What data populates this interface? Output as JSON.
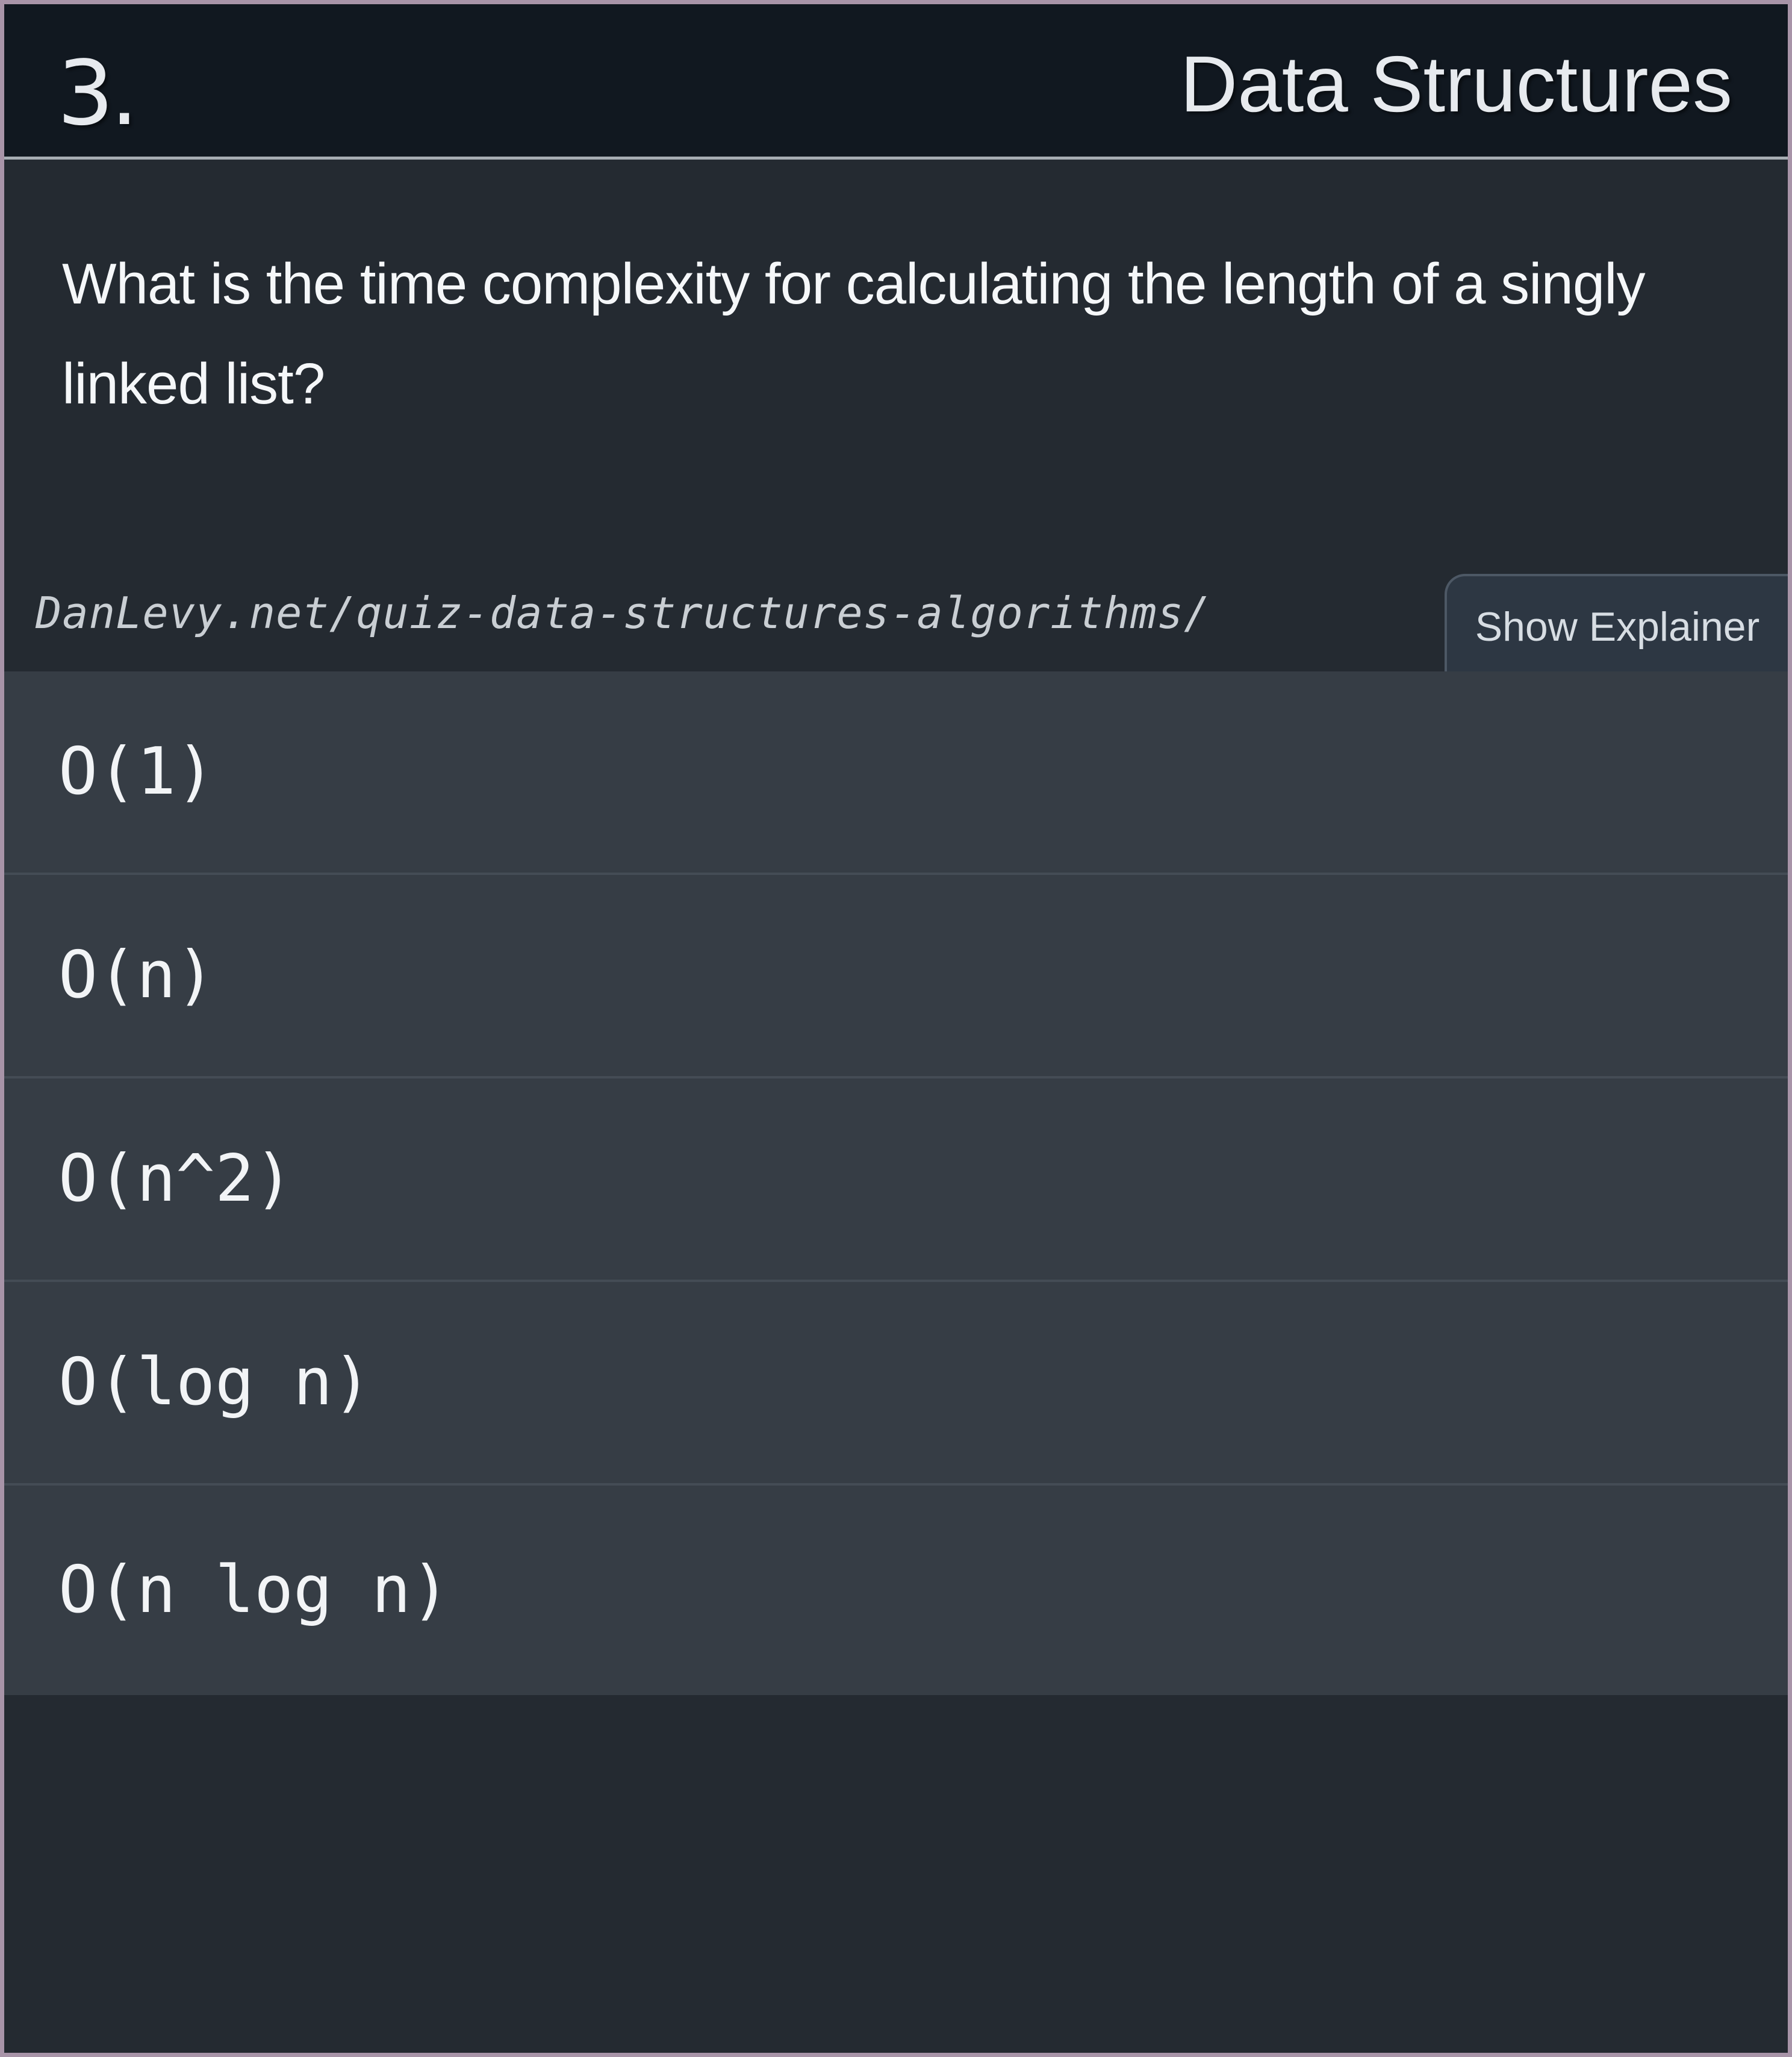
{
  "header": {
    "question_number": "3.",
    "topic": "Data Structures"
  },
  "question": {
    "text": "What is the time complexity for calculating the length of a singly linked list?"
  },
  "source": {
    "url": "DanLevy.net/quiz-data-structures-algorithms/"
  },
  "controls": {
    "show_explainer_label": "Show Explainer"
  },
  "choices": [
    {
      "label": "O(1)"
    },
    {
      "label": "O(n)"
    },
    {
      "label": "O(n^2)"
    },
    {
      "label": "O(log n)"
    },
    {
      "label": "O(n log n)"
    }
  ],
  "colors": {
    "page_background": "#242a31",
    "header_background": "#111820",
    "choice_background": "#363d45",
    "button_background": "#2d3743",
    "text": "#f2f4f6",
    "frame": "#a894a8"
  }
}
